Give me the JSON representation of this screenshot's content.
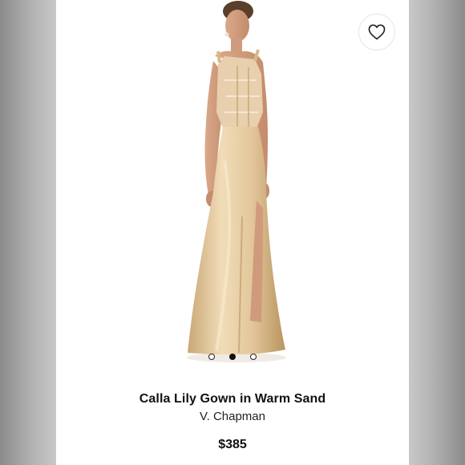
{
  "product": {
    "name": "Calla Lily Gown in Warm Sand",
    "brand": "V. Chapman",
    "price": "$385"
  },
  "gallery": {
    "image_count": 3,
    "active_index": 1
  },
  "icons": {
    "favorite": "heart-icon"
  },
  "colors": {
    "dress": "#e3c79c",
    "background": "#ffffff",
    "dot_active": "#111111"
  }
}
